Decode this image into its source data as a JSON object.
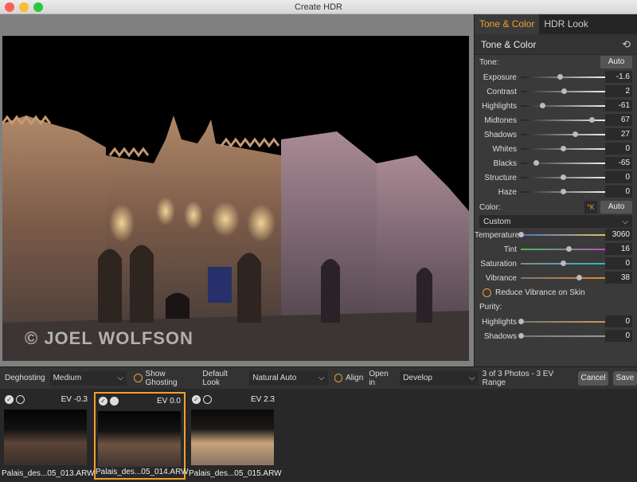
{
  "window": {
    "title": "Create HDR"
  },
  "photo": {
    "watermark": "© JOEL WOLFSON"
  },
  "panel": {
    "tabs": [
      {
        "label": "Tone & Color",
        "active": true
      },
      {
        "label": "HDR Look",
        "active": false
      }
    ],
    "section_title": "Tone & Color",
    "tone": {
      "label": "Tone:",
      "auto": "Auto",
      "sliders": [
        {
          "label": "Exposure",
          "value": "-1.6",
          "pos": 0.46
        },
        {
          "label": "Contrast",
          "value": "2",
          "pos": 0.51
        },
        {
          "label": "Highlights",
          "value": "-61",
          "pos": 0.25
        },
        {
          "label": "Midtones",
          "value": "67",
          "pos": 0.84
        },
        {
          "label": "Shadows",
          "value": "27",
          "pos": 0.64
        },
        {
          "label": "Whites",
          "value": "0",
          "pos": 0.5
        },
        {
          "label": "Blacks",
          "value": "-65",
          "pos": 0.18
        },
        {
          "label": "Structure",
          "value": "0",
          "pos": 0.5
        },
        {
          "label": "Haze",
          "value": "0",
          "pos": 0.5
        }
      ]
    },
    "color": {
      "label": "Color:",
      "k_label": "°K",
      "auto": "Auto",
      "preset": "Custom",
      "sliders": [
        {
          "label": "Temperature",
          "value": "3060",
          "pos": 0.0
        },
        {
          "label": "Tint",
          "value": "16",
          "pos": 0.57
        },
        {
          "label": "Saturation",
          "value": "0",
          "pos": 0.5
        },
        {
          "label": "Vibrance",
          "value": "38",
          "pos": 0.69
        }
      ],
      "reduce_vibrance": "Reduce Vibrance on Skin"
    },
    "purity": {
      "label": "Purity:",
      "sliders": [
        {
          "label": "Highlights",
          "value": "0",
          "pos": 0.0
        },
        {
          "label": "Shadows",
          "value": "0",
          "pos": 0.0
        }
      ]
    }
  },
  "toolbar": {
    "deghosting_label": "Deghosting",
    "deghosting_value": "Medium",
    "show_ghosting": "Show Ghosting",
    "default_look_label": "Default Look",
    "default_look_value": "Natural Auto",
    "align": "Align",
    "open_in_label": "Open in",
    "open_in_value": "Develop",
    "photo_count": "3 of 3 Photos - 3 EV Range",
    "cancel": "Cancel",
    "save": "Save"
  },
  "filmstrip": [
    {
      "ev": "EV -0.3",
      "caption": "Palais_des...05_013.ARW",
      "selected": false
    },
    {
      "ev": "EV 0.0",
      "caption": "Palais_des...05_014.ARW",
      "selected": true
    },
    {
      "ev": "EV 2.3",
      "caption": "Palais_des...05_015.ARW",
      "selected": false
    }
  ],
  "colors": {
    "accent": "#f0a030"
  },
  "icons": {
    "reset": "reset-icon",
    "chevron": "chevron-down-icon",
    "check": "checkmark-icon"
  }
}
